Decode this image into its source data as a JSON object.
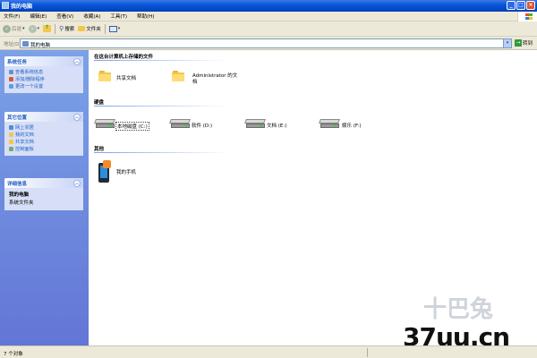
{
  "window": {
    "title": "我的电脑"
  },
  "menu": [
    "文件(F)",
    "编辑(E)",
    "查看(V)",
    "收藏(A)",
    "工具(T)",
    "帮助(H)"
  ],
  "toolbar": {
    "back_label": "后退",
    "search_label": "搜索",
    "folders_label": "文件夹"
  },
  "address": {
    "label": "地址(D)",
    "value": "我的电脑",
    "go_label": "转到"
  },
  "panels": {
    "system_tasks": {
      "title": "系统任务",
      "items": [
        "查看系统信息",
        "添加/删除程序",
        "更改一个设置"
      ]
    },
    "other_places": {
      "title": "其它位置",
      "items": [
        "网上邻居",
        "我的文档",
        "共享文档",
        "控制面板"
      ]
    },
    "details": {
      "title": "详细信息",
      "name": "我的电脑",
      "subtitle": "系统文件夹"
    }
  },
  "content": {
    "files_group": {
      "title": "在这台计算机上存储的文件",
      "items": [
        "共享文档",
        "Administrator 的文",
        "档"
      ]
    },
    "drives_group": {
      "title": "硬盘",
      "items": [
        "本地磁盘 (C:)",
        "软件 (D:)",
        "文档 (E:)",
        "娱乐 (F:)"
      ]
    },
    "other_group": {
      "title": "其他",
      "items": [
        "我的手机"
      ]
    }
  },
  "status": {
    "text": "7 个对象"
  },
  "watermark": {
    "text": "37uu.cn",
    "faint": "十巴兔"
  }
}
